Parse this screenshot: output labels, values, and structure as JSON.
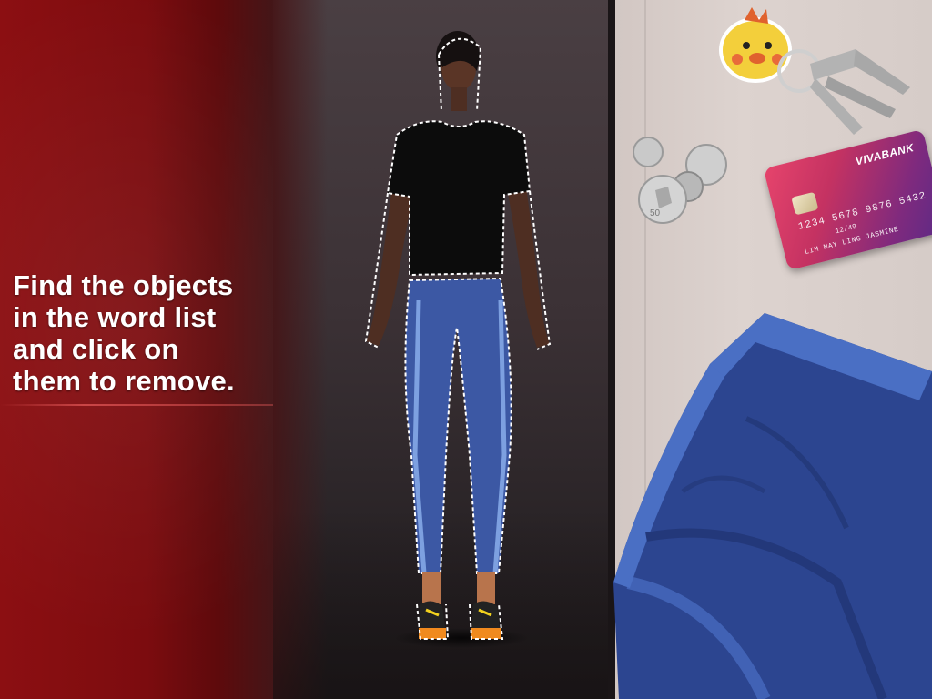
{
  "instruction": "Find the objects\nin the word list\nand click on\nthem to remove.",
  "items": {
    "keychain": {
      "icon": "chick-keychain-with-keys-icon"
    },
    "coins": {
      "icon": "coins-icon",
      "coin_value": "50"
    },
    "credit_card": {
      "icon": "credit-card-icon",
      "bank": "VIVABANK",
      "number": "1234 5678 9876 5432",
      "expiry": "12/49",
      "holder": "LIM MAY LING JASMINE"
    },
    "pants": {
      "icon": "blue-leggings-icon"
    }
  },
  "character": {
    "icon": "woman-character-icon",
    "shirt_color": "#0c0c0c",
    "pants_color": "#3c58a4",
    "shoe_color": "#f08a1e"
  },
  "colors": {
    "panel_red": "#8c0f12",
    "table": "#d6ccc8"
  }
}
